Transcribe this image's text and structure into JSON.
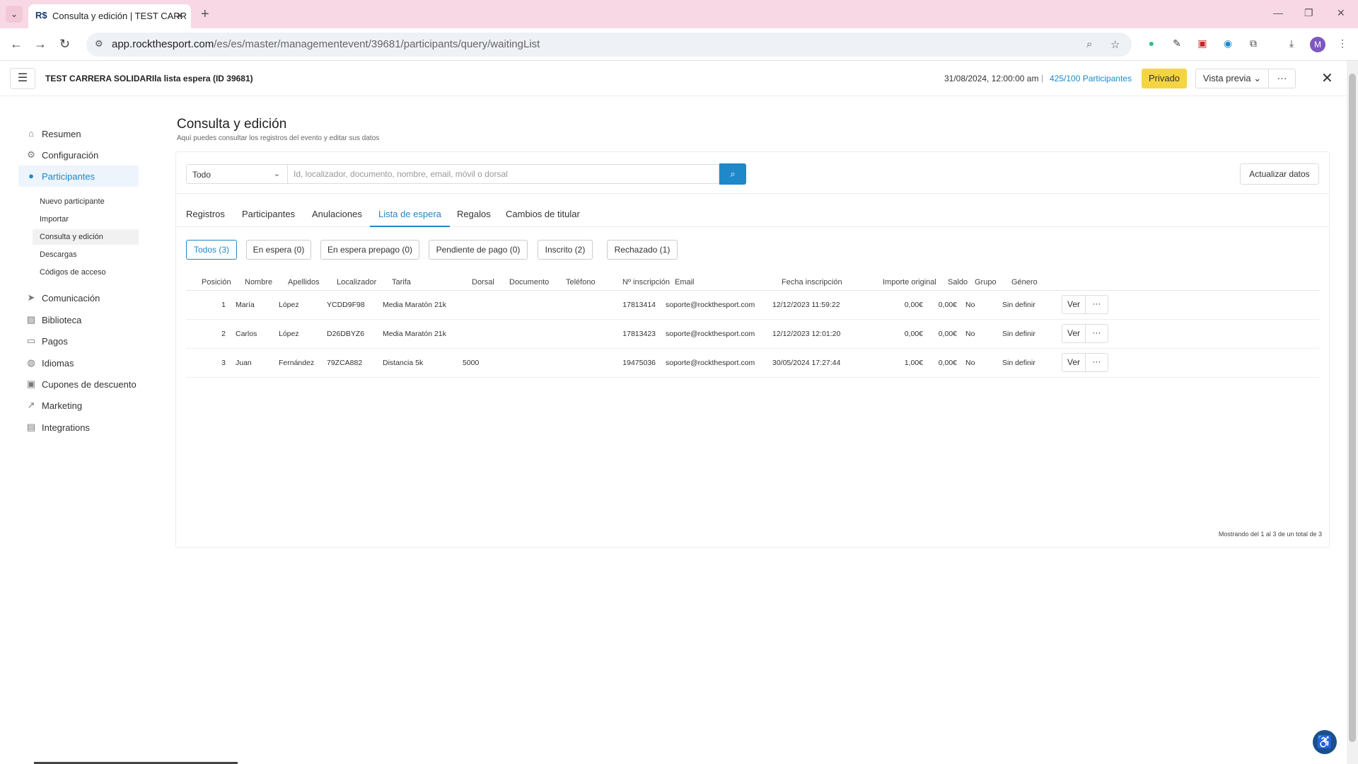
{
  "browser": {
    "tab_title": "Consulta y edición | TEST CARR",
    "favicon_text": "R$",
    "url_host": "app.rockthesport.com",
    "url_path": "/es/es/master/managementevent/39681/participants/query/waitingList",
    "profile_initial": "M",
    "icons": [
      "back-icon",
      "forward-icon",
      "reload-icon",
      "zoom-icon",
      "star-icon",
      "extension-icon",
      "download-icon",
      "menu-icon"
    ]
  },
  "header": {
    "event_title": "TEST CARRERA SOLIDARIla lista espera (ID 39681)",
    "event_date": "31/08/2024, 12:00:00 am",
    "separator": "|",
    "participants_count": "425/100 Participantes",
    "private_label": "Privado",
    "preview_label": "Vista previa",
    "more_label": "···",
    "accent_color": "#1e88c8",
    "private_color": "#f5d442"
  },
  "sidebar": {
    "items": [
      {
        "label": "Resumen",
        "icon": "home-icon"
      },
      {
        "label": "Configuración",
        "icon": "gear-icon"
      },
      {
        "label": "Participantes",
        "icon": "user-icon"
      },
      {
        "label": "Comunicación",
        "icon": "send-icon"
      },
      {
        "label": "Biblioteca",
        "icon": "image-icon"
      },
      {
        "label": "Pagos",
        "icon": "card-icon"
      },
      {
        "label": "Idiomas",
        "icon": "globe-icon"
      },
      {
        "label": "Cupones de descuento",
        "icon": "coupon-icon"
      },
      {
        "label": "Marketing",
        "icon": "chart-icon"
      },
      {
        "label": "Integrations",
        "icon": "integration-icon"
      }
    ],
    "subitems": [
      {
        "label": "Nuevo participante"
      },
      {
        "label": "Importar"
      },
      {
        "label": "Consulta y edición"
      },
      {
        "label": "Descargas"
      },
      {
        "label": "Códigos de acceso"
      }
    ]
  },
  "main": {
    "title": "Consulta y edición",
    "subtitle": "Aquí puedes consultar los registros del evento y editar sus datos",
    "filter_value": "Todo",
    "search_placeholder": "Id, localizador, documento, nombre, email, móvil o dorsal",
    "refresh_label": "Actualizar datos",
    "tabs": [
      {
        "label": "Registros"
      },
      {
        "label": "Participantes"
      },
      {
        "label": "Anulaciones"
      },
      {
        "label": "Lista de espera"
      },
      {
        "label": "Regalos"
      },
      {
        "label": "Cambios de titular"
      }
    ],
    "pills": [
      {
        "label": "Todos (3)"
      },
      {
        "label": "En espera (0)"
      },
      {
        "label": "En espera prepago (0)"
      },
      {
        "label": "Pendiente de pago (0)"
      },
      {
        "label": "Inscrito (2)"
      },
      {
        "label": "Rechazado (1)"
      }
    ],
    "columns": [
      "Posición",
      "Nombre",
      "Apellidos",
      "Localizador",
      "Tarifa",
      "Dorsal",
      "Documento",
      "Teléfono",
      "Nº inscripción",
      "Email",
      "Fecha inscripción",
      "Importe original",
      "Saldo",
      "Grupo",
      "Género"
    ],
    "rows": [
      {
        "pos": "1",
        "nombre": "María",
        "apellidos": "López",
        "localizador": "YCDD9F98",
        "tarifa": "Media Maratón 21k",
        "dorsal": "",
        "documento": "",
        "telefono": "",
        "inscripcion": "17813414",
        "email": "soporte@rockthesport.com",
        "fecha": "12/12/2023 11:59:22",
        "importe": "0,00€",
        "saldo": "0,00€",
        "grupo": "No",
        "genero": "Sin definir"
      },
      {
        "pos": "2",
        "nombre": "Carlos",
        "apellidos": "López",
        "localizador": "D26DBYZ6",
        "tarifa": "Media Maratón 21k",
        "dorsal": "",
        "documento": "",
        "telefono": "",
        "inscripcion": "17813423",
        "email": "soporte@rockthesport.com",
        "fecha": "12/12/2023 12:01:20",
        "importe": "0,00€",
        "saldo": "0,00€",
        "grupo": "No",
        "genero": "Sin definir"
      },
      {
        "pos": "3",
        "nombre": "Juan",
        "apellidos": "Fernández",
        "localizador": "79ZCA882",
        "tarifa": "Distancia 5k",
        "dorsal": "5000",
        "documento": "",
        "telefono": "",
        "inscripcion": "19475036",
        "email": "soporte@rockthesport.com",
        "fecha": "30/05/2024 17:27:44",
        "importe": "1,00€",
        "saldo": "0,00€",
        "grupo": "No",
        "genero": "Sin definir"
      }
    ],
    "ver_label": "Ver",
    "row_more_label": "···",
    "footer_count": "Mostrando del 1 al 3 de un total de 3"
  }
}
